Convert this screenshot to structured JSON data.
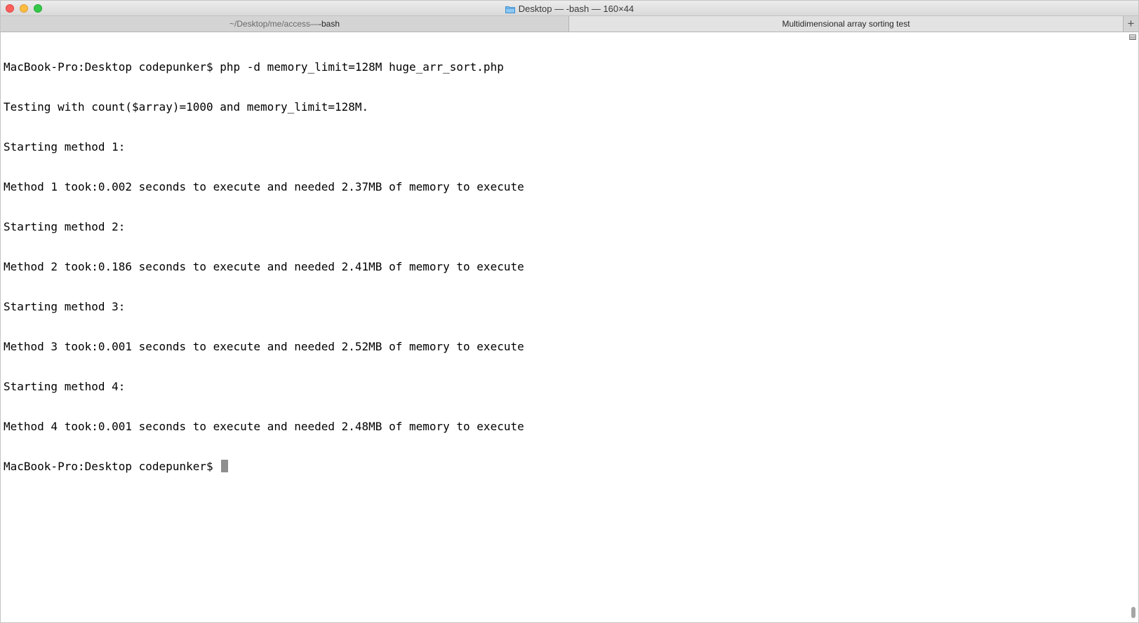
{
  "window": {
    "title": "Desktop — -bash — 160×44"
  },
  "tabs": [
    {
      "label_path": "~/Desktop/me/access",
      "label_sep": " — ",
      "label_proc": "-bash"
    },
    {
      "label": "Multidimensional array sorting test"
    }
  ],
  "new_tab_label": "+",
  "icons": {
    "title": "folder-icon",
    "new_tab": "plus-icon",
    "scroll": "scroll-marker-icon"
  },
  "terminal": {
    "lines": [
      "MacBook-Pro:Desktop codepunker$ php -d memory_limit=128M huge_arr_sort.php",
      "Testing with count($array)=1000 and memory_limit=128M.",
      "Starting method 1:",
      "Method 1 took:0.002 seconds to execute and needed 2.37MB of memory to execute",
      "Starting method 2:",
      "Method 2 took:0.186 seconds to execute and needed 2.41MB of memory to execute",
      "Starting method 3:",
      "Method 3 took:0.001 seconds to execute and needed 2.52MB of memory to execute",
      "Starting method 4:",
      "Method 4 took:0.001 seconds to execute and needed 2.48MB of memory to execute"
    ],
    "prompt": "MacBook-Pro:Desktop codepunker$ "
  },
  "colors": {
    "close": "#fc605c",
    "minimize": "#fdbc40",
    "maximize": "#34c84a",
    "folder": "#5aa9e6",
    "cursor": "#8e8e8e"
  }
}
